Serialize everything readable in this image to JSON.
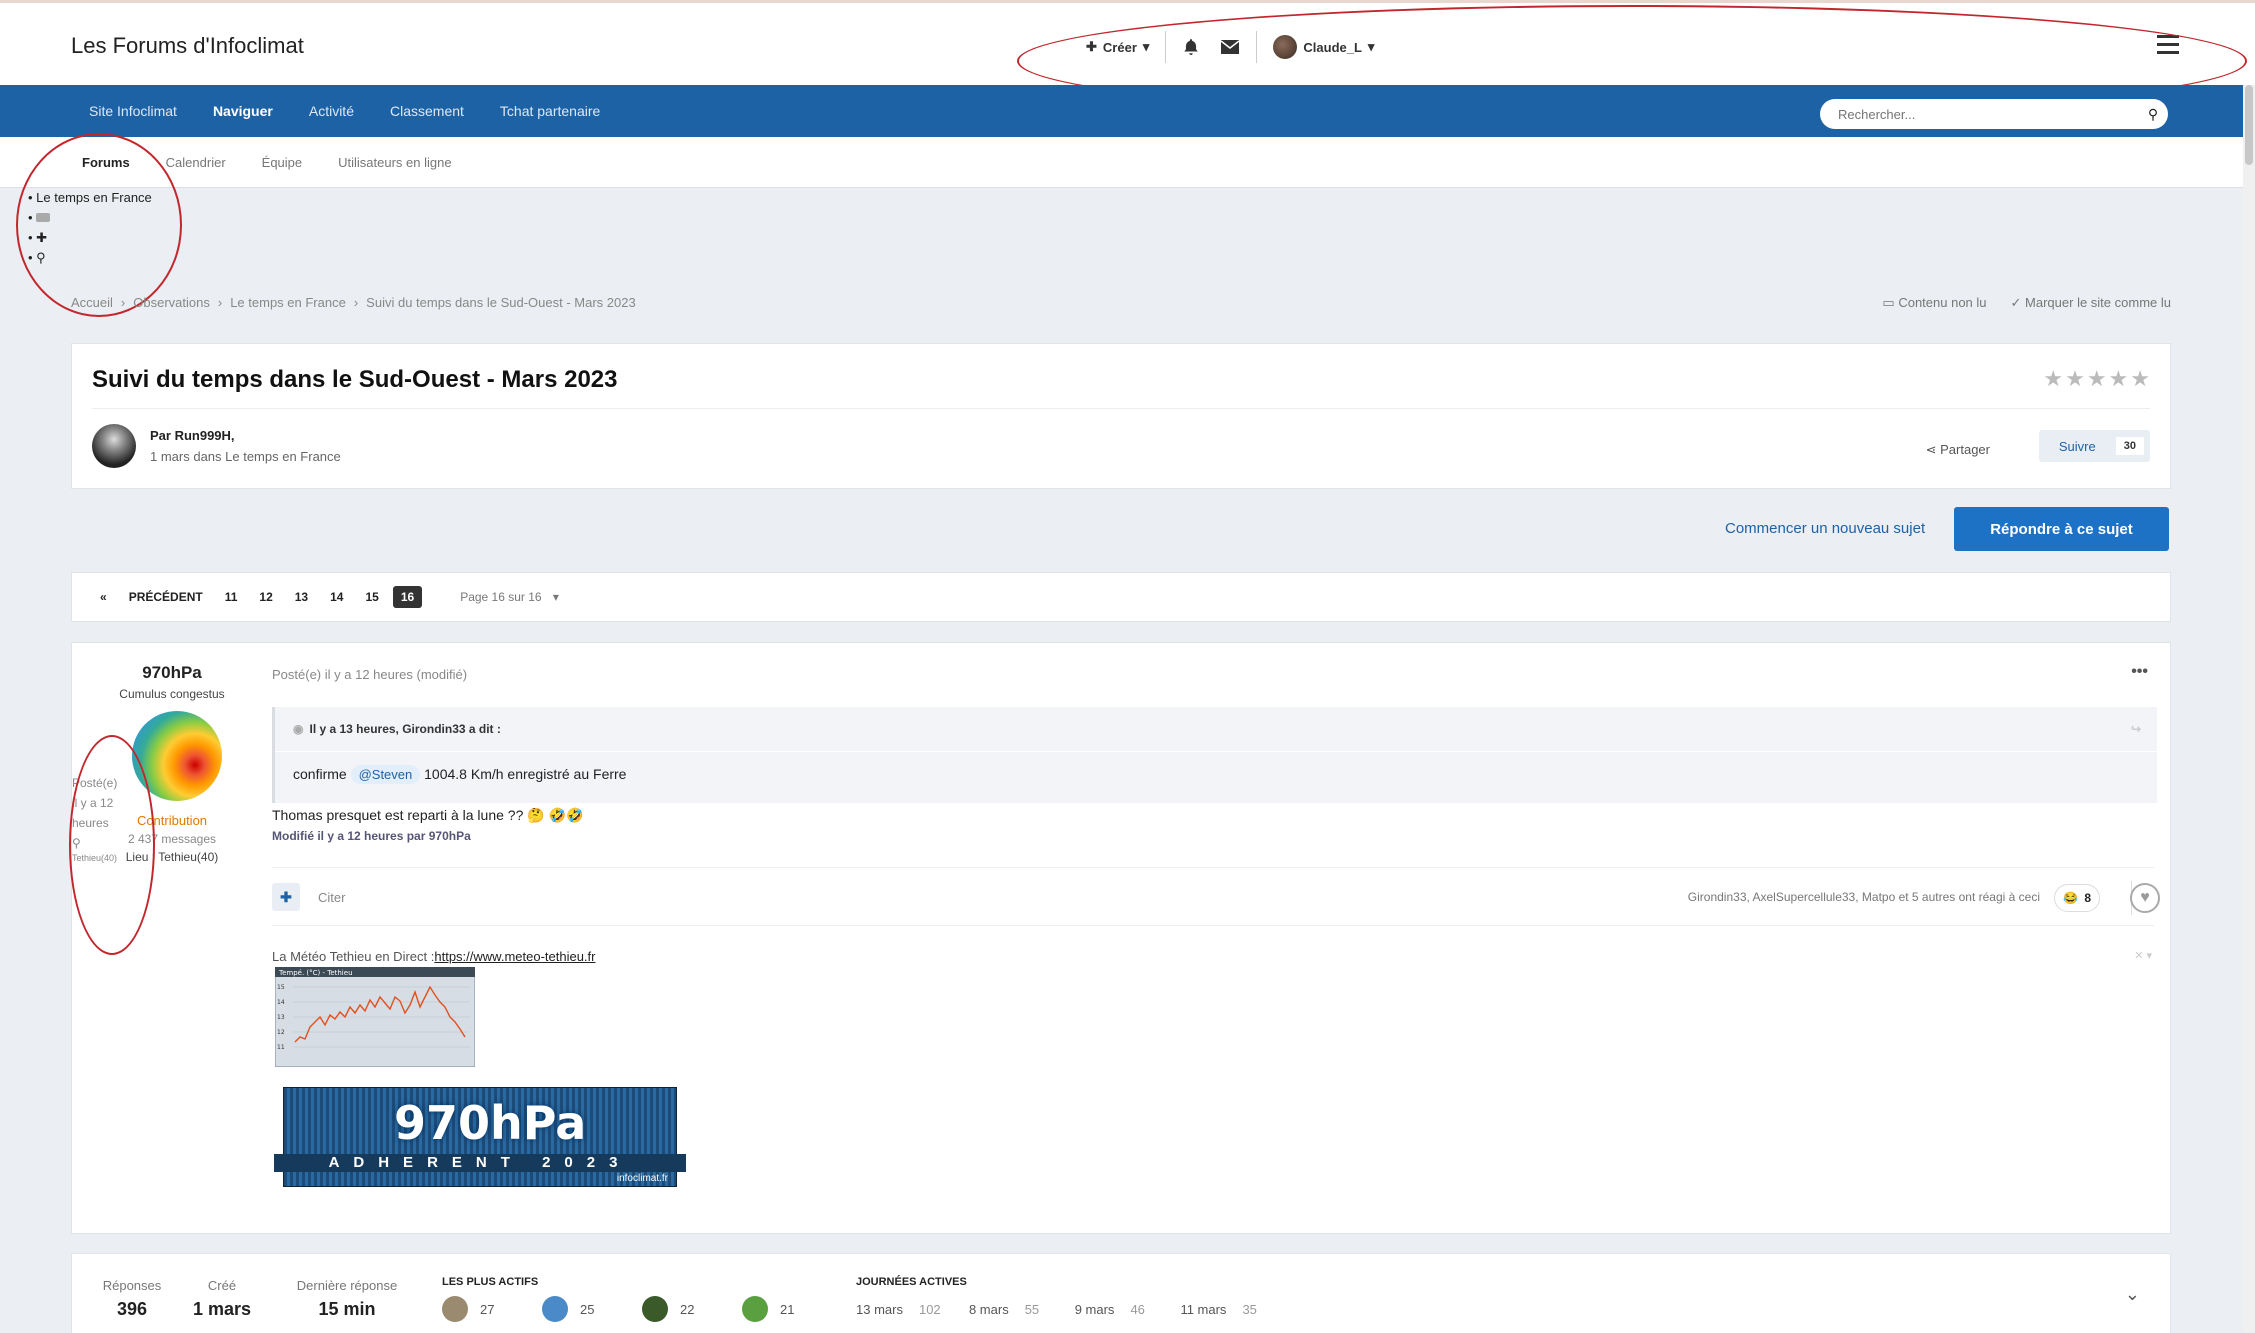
{
  "header": {
    "site_title": "Les Forums d'Infoclimat",
    "create_label": "Créer",
    "username": "Claude_L"
  },
  "nav": {
    "items": [
      "Site Infoclimat",
      "Naviguer",
      "Activité",
      "Classement",
      "Tchat partenaire"
    ],
    "search_placeholder": "Rechercher..."
  },
  "subnav": {
    "items": [
      "Forums",
      "Calendrier",
      "Équipe",
      "Utilisateurs en ligne"
    ]
  },
  "bullets": {
    "first": "Le temps en France"
  },
  "breadcrumb": {
    "items": [
      "Accueil",
      "Observations",
      "Le temps en France",
      "Suivi du temps dans le Sud-Ouest - Mars 2023"
    ],
    "unread": "Contenu non lu",
    "mark_read": "Marquer le site comme lu"
  },
  "topic": {
    "title": "Suivi du temps dans le Sud-Ouest - Mars 2023",
    "by": "Par Run999H,",
    "meta": "1 mars dans Le temps en France",
    "share": "Partager",
    "follow": "Suivre",
    "follow_count": "30"
  },
  "actions": {
    "new_topic": "Commencer un nouveau sujet",
    "reply": "Répondre à ce sujet"
  },
  "pagination": {
    "prev": "PRÉCÉDENT",
    "pages": [
      "11",
      "12",
      "13",
      "14",
      "15",
      "16"
    ],
    "info": "Page 16 sur 16"
  },
  "post": {
    "author": "970hPa",
    "rank": "Cumulus congestus",
    "group": "Contribution",
    "messages": "2 437 messages",
    "location": "Lieu : Tethieu(40)",
    "side_posted": "Posté(e) il y a 12 heures",
    "side_loc": "Tethieu(40)",
    "posted": "Posté(e) il y a 12 heures (modifié)",
    "quote_header": "Il y a 13 heures, Girondin33 a dit :",
    "quote_pre": "confirme",
    "quote_mention": "@Steven",
    "quote_post": "1004.8 Km/h enregistré au Ferre",
    "body": "Thomas presquet est reparti à la lune ?? 🤔 🤣🤣",
    "edited": "Modifié il y a 12 heures par 970hPa",
    "quote_btn": "Citer",
    "reactions_text": "Girondin33, AxelSupercellule33, Matpo et 5 autres ont réagi à ceci",
    "reaction_count": "8",
    "sig_text": "La Météo Tethieu en Direct :",
    "sig_link": "https://www.meteo-tethieu.fr",
    "banner_big": "970hPa",
    "banner_sub": "ADHERENT 2023",
    "banner_site": "infoclimat.fr",
    "graph_title": "Tempé. (°C) - Tethieu"
  },
  "stats": {
    "replies_label": "Réponses",
    "replies": "396",
    "created_label": "Créé",
    "created": "1 mars",
    "last_label": "Dernière réponse",
    "last": "15 min",
    "active_label": "LES PLUS ACTIFS",
    "active": [
      "27",
      "25",
      "22",
      "21"
    ],
    "days_label": "JOURNÉES ACTIVES",
    "days": [
      {
        "d": "13 mars",
        "n": "102"
      },
      {
        "d": "8 mars",
        "n": "55"
      },
      {
        "d": "9 mars",
        "n": "46"
      },
      {
        "d": "11 mars",
        "n": "35"
      }
    ]
  }
}
